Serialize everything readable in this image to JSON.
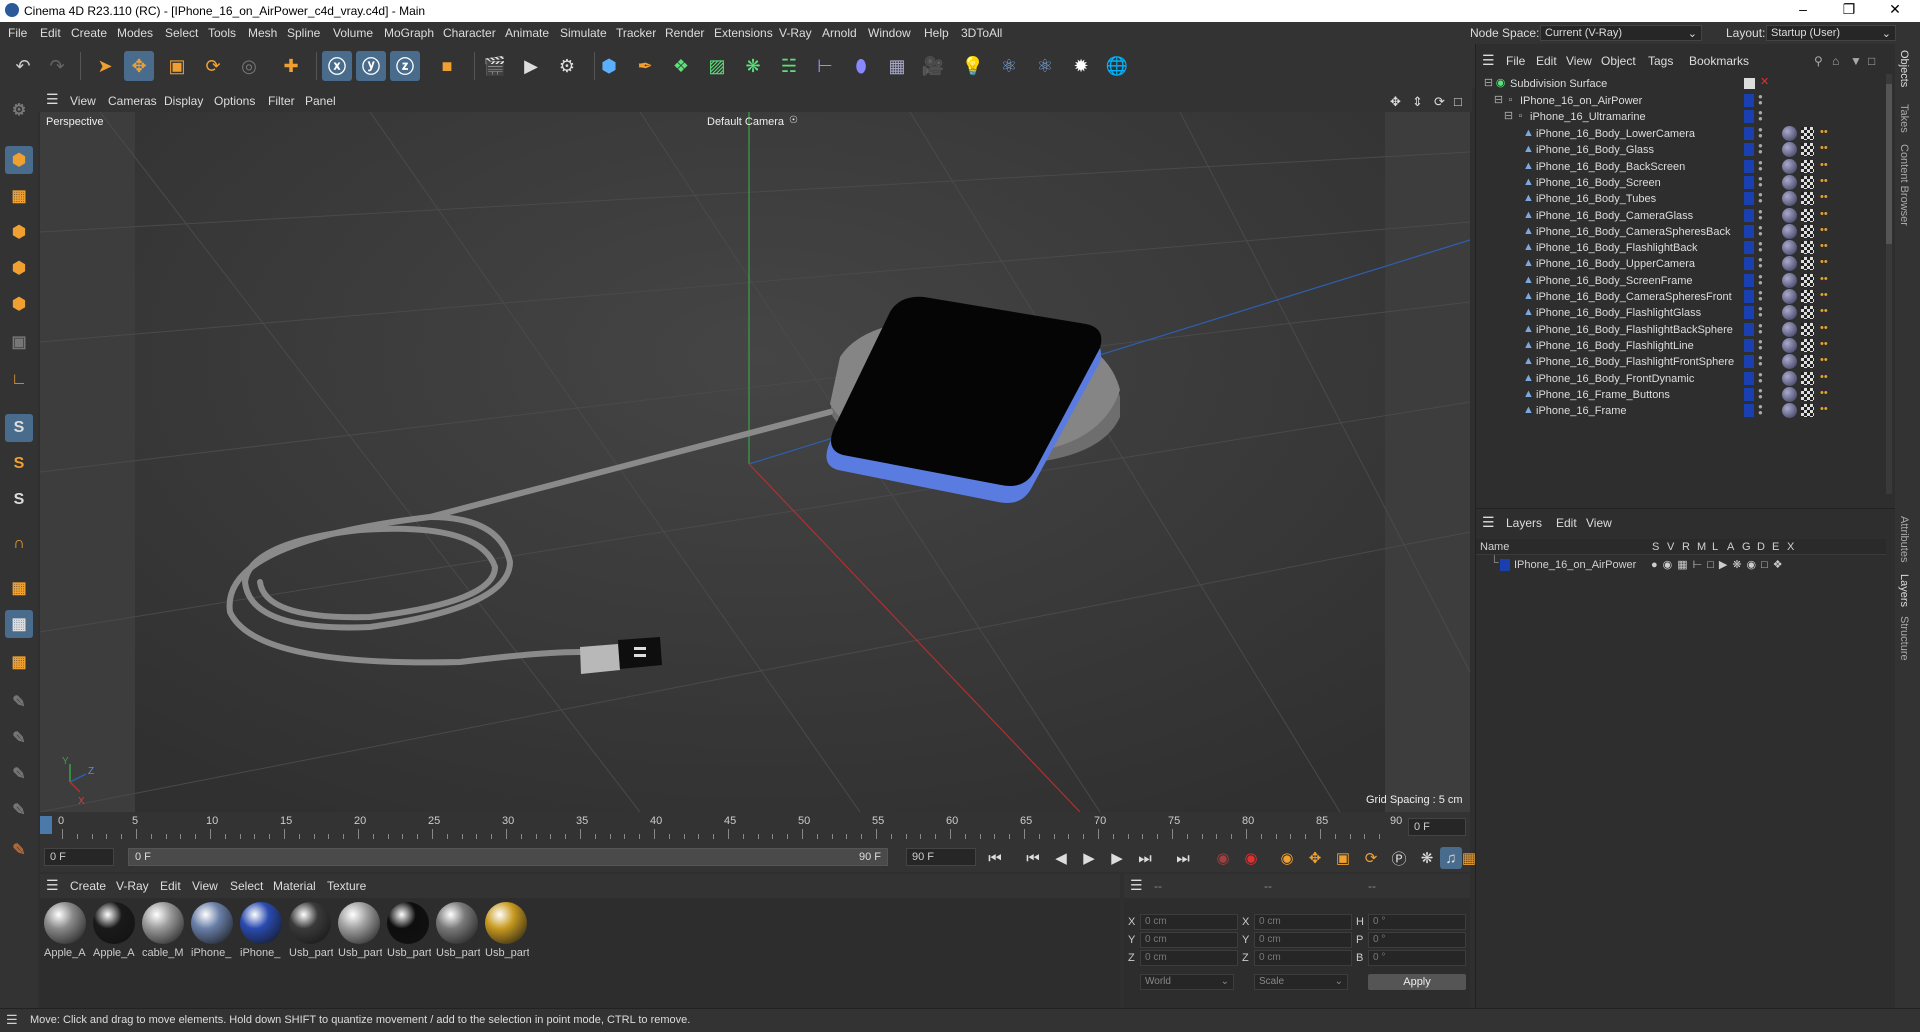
{
  "window": {
    "title": "Cinema 4D R23.110 (RC) - [IPhone_16_on_AirPower_c4d_vray.c4d] - Main"
  },
  "menubar": {
    "items": [
      "File",
      "Edit",
      "Create",
      "Modes",
      "Select",
      "Tools",
      "Mesh",
      "Spline",
      "Volume",
      "MoGraph",
      "Character",
      "Animate",
      "Simulate",
      "Tracker",
      "Render",
      "Extensions",
      "V-Ray",
      "Arnold",
      "Window",
      "Help",
      "3DToAll"
    ],
    "node_space_label": "Node Space:",
    "node_space_value": "Current (V-Ray)",
    "layout_label": "Layout:",
    "layout_value": "Startup (User)"
  },
  "viewport": {
    "menu": [
      "View",
      "Cameras",
      "Display",
      "Options",
      "Filter",
      "Panel"
    ],
    "name": "Perspective",
    "camera": "Default Camera",
    "grid_spacing": "Grid Spacing : 5 cm",
    "axis_labels": {
      "y": "Y",
      "z": "Z",
      "x": "X"
    }
  },
  "timeline": {
    "ticks": [
      "0",
      "5",
      "10",
      "15",
      "20",
      "25",
      "30",
      "35",
      "40",
      "45",
      "50",
      "55",
      "60",
      "65",
      "70",
      "75",
      "80",
      "85",
      "90"
    ],
    "current_frame": "0 F"
  },
  "transport": {
    "start_field": "0 F",
    "range_start": "0 F",
    "range_end": "90 F",
    "end_field": "90 F"
  },
  "materials": {
    "menu": [
      "Create",
      "V-Ray",
      "Edit",
      "View",
      "Select",
      "Material",
      "Texture"
    ],
    "items": [
      {
        "label": "Apple_A",
        "color": "#8a8a8a"
      },
      {
        "label": "Apple_A",
        "color": "#1a1a1a"
      },
      {
        "label": "cable_M",
        "color": "#9a9a9a"
      },
      {
        "label": "iPhone_",
        "color": "#6a7fa8"
      },
      {
        "label": "iPhone_",
        "color": "#2a4bb0"
      },
      {
        "label": "Usb_part",
        "color": "#3a3a3a"
      },
      {
        "label": "Usb_part",
        "color": "#a0a0a0"
      },
      {
        "label": "Usb_part",
        "color": "#0e0e0e"
      },
      {
        "label": "Usb_part",
        "color": "#7a7a7a"
      },
      {
        "label": "Usb_part",
        "color": "#c89a20"
      }
    ]
  },
  "coordinates": {
    "header": [
      "--",
      "--",
      "--"
    ],
    "rows": [
      {
        "a": "X",
        "av": "0 cm",
        "b": "X",
        "bv": "0 cm",
        "c": "H",
        "cv": "0 °"
      },
      {
        "a": "Y",
        "av": "0 cm",
        "b": "Y",
        "bv": "0 cm",
        "c": "P",
        "cv": "0 °"
      },
      {
        "a": "Z",
        "av": "0 cm",
        "b": "Z",
        "bv": "0 cm",
        "c": "B",
        "cv": "0 °"
      }
    ],
    "mode": "World",
    "scale": "Scale",
    "apply": "Apply"
  },
  "objects": {
    "menu": [
      "File",
      "Edit",
      "View",
      "Object",
      "Tags",
      "Bookmarks"
    ],
    "root": "Subdivision Surface",
    "group": "IPhone_16_on_AirPower",
    "subgroup": "iPhone_16_Ultramarine",
    "children": [
      "iPhone_16_Body_LowerCamera",
      "iPhone_16_Body_Glass",
      "iPhone_16_Body_BackScreen",
      "iPhone_16_Body_Screen",
      "iPhone_16_Body_Tubes",
      "iPhone_16_Body_CameraGlass",
      "iPhone_16_Body_CameraSpheresBack",
      "iPhone_16_Body_FlashlightBack",
      "iPhone_16_Body_UpperCamera",
      "iPhone_16_Body_ScreenFrame",
      "iPhone_16_Body_CameraSpheresFront",
      "iPhone_16_Body_FlashlightGlass",
      "iPhone_16_Body_FlashlightBackSphere",
      "iPhone_16_Body_FlashlightLine",
      "iPhone_16_Body_FlashlightFrontSphere",
      "iPhone_16_Body_FrontDynamic",
      "iPhone_16_Frame_Buttons",
      "iPhone_16_Frame"
    ]
  },
  "layers": {
    "menu": [
      "Layers",
      "Edit",
      "View"
    ],
    "col_name": "Name",
    "flags": [
      "S",
      "V",
      "R",
      "M",
      "L",
      "A",
      "G",
      "D",
      "E",
      "X"
    ],
    "item": "IPhone_16_on_AirPower"
  },
  "sidetabs": [
    "Objects",
    "Takes",
    "Content Browser",
    "Attributes",
    "Layers",
    "Structure"
  ],
  "status": "Move: Click and drag to move elements. Hold down SHIFT to quantize movement / add to the selection in point mode, CTRL to remove.",
  "colors": {
    "accent": "#4a6c8c",
    "layer_blue": "#1a3fb0",
    "phone_blue": "#5a7be0"
  }
}
